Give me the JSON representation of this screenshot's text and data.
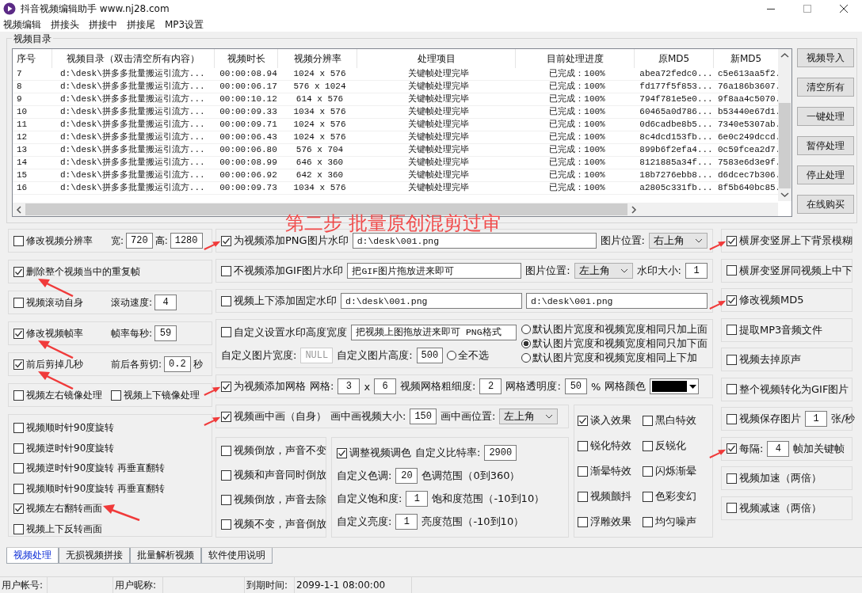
{
  "window": {
    "title": "抖音视频编辑助手 www.nj28.com"
  },
  "menu": [
    "视频编辑",
    "拼接头",
    "拼接中",
    "拼接尾",
    "MP3设置"
  ],
  "video_list": {
    "title": "视频目录",
    "columns": [
      "序号",
      "视频目录（双击清空所有内容）",
      "视频时长",
      "视频分辨率",
      "处理项目",
      "目前处理进度",
      "原MD5",
      "新MD5"
    ],
    "rows": [
      [
        "7",
        "d:\\desk\\拼多多批量搬运引流方...",
        "00:00:08.94",
        "1024 x 576",
        "关键帧处理完毕",
        "已完成：100%",
        "abea72fedc0...",
        "c5e613aa5f2."
      ],
      [
        "8",
        "d:\\desk\\拼多多批量搬运引流方...",
        "00:00:06.17",
        "576 x 1024",
        "关键帧处理完毕",
        "已完成：100%",
        "fd177f5f853...",
        "76a186b3607."
      ],
      [
        "9",
        "d:\\desk\\拼多多批量搬运引流方...",
        "00:00:10.12",
        "614 x 576",
        "关键帧处理完毕",
        "已完成：100%",
        "794f781e5e0...",
        "9f8aa4c5070."
      ],
      [
        "10",
        "d:\\desk\\拼多多批量搬运引流方...",
        "00:00:09.33",
        "1034 x 576",
        "关键帧处理完毕",
        "已完成：100%",
        "60465a0d786...",
        "b53440e67d1."
      ],
      [
        "11",
        "d:\\desk\\拼多多批量搬运引流方...",
        "00:00:09.71",
        "1024 x 576",
        "关键帧处理完毕",
        "已完成：100%",
        "0d6cadbe8b5...",
        "7340e5307ab."
      ],
      [
        "12",
        "d:\\desk\\拼多多批量搬运引流方...",
        "00:00:06.43",
        "1024 x 576",
        "关键帧处理完毕",
        "已完成：100%",
        "8c4dcd153fb...",
        "6e0c249dccd."
      ],
      [
        "13",
        "d:\\desk\\拼多多批量搬运引流方...",
        "00:00:06.80",
        "576 x 704",
        "关键帧处理完毕",
        "已完成：100%",
        "899b6f2efa4...",
        "0c59fcea2d7."
      ],
      [
        "14",
        "d:\\desk\\拼多多批量搬运引流方...",
        "00:00:08.99",
        "646 x 360",
        "关键帧处理完毕",
        "已完成：100%",
        "8121885a34f...",
        "7583e6d3e9f."
      ],
      [
        "15",
        "d:\\desk\\拼多多批量搬运引流方...",
        "00:00:06.92",
        "642 x 360",
        "关键帧处理完毕",
        "已完成：100%",
        "18b7276ebb8...",
        "d6dcec7b306."
      ],
      [
        "16",
        "d:\\desk\\拼多多批量搬运引流方...",
        "00:00:09.73",
        "1034 x 576",
        "关键帧处理完毕",
        "已完成：100%",
        "a2805c331fb...",
        "8f5b640bc85."
      ]
    ]
  },
  "side_buttons": [
    "视频导入",
    "清空所有",
    "一键处理",
    "暂停处理",
    "停止处理",
    "在线购买"
  ],
  "step_caption": "第二步 批量原创混剪过审",
  "left_panels": [
    {
      "lines": [
        [
          {
            "kind": "checkbox",
            "label": "修改视频分辨率",
            "checked": false
          },
          {
            "kind": "label",
            "text": "宽:"
          },
          {
            "kind": "field",
            "value": "720"
          },
          {
            "kind": "label",
            "text": "高:"
          },
          {
            "kind": "field",
            "value": "1280"
          }
        ]
      ]
    },
    {
      "lines": [
        [
          {
            "kind": "checkbox",
            "label": "删除整个视频当中的重复帧",
            "checked": true,
            "arrow": true
          }
        ]
      ]
    },
    {
      "lines": [
        [
          {
            "kind": "checkbox",
            "label": "视频滚动自身",
            "checked": false
          },
          {
            "kind": "label",
            "text": "滚动速度:"
          },
          {
            "kind": "field",
            "value": "4"
          }
        ]
      ]
    },
    {
      "lines": [
        [
          {
            "kind": "checkbox",
            "label": "修改视频帧率",
            "checked": true,
            "arrow": true
          },
          {
            "kind": "label",
            "text": "帧率每秒:"
          },
          {
            "kind": "field",
            "value": "59"
          }
        ]
      ]
    },
    {
      "lines": [
        [
          {
            "kind": "checkbox",
            "label": "前后剪掉几秒",
            "checked": true,
            "arrow": true
          },
          {
            "kind": "label",
            "text": "前后各剪切:"
          },
          {
            "kind": "field",
            "value": "0.2"
          },
          {
            "kind": "label",
            "text": "秒"
          }
        ]
      ]
    },
    {
      "lines": [
        [
          {
            "kind": "checkbox",
            "label": "视频左右镜像处理",
            "checked": false
          },
          {
            "kind": "checkbox",
            "label": "视频上下镜像处理",
            "checked": false
          }
        ]
      ]
    },
    {
      "lines": [
        [
          {
            "kind": "checkbox",
            "label": "视频顺时针90度旋转",
            "checked": false
          }
        ],
        [
          {
            "kind": "checkbox",
            "label": "视频逆时针90度旋转",
            "checked": false
          }
        ],
        [
          {
            "kind": "checkbox",
            "label": "视频逆时针90度旋转 再垂直翻转",
            "checked": false
          }
        ],
        [
          {
            "kind": "checkbox",
            "label": "视频顺时针90度旋转 再垂直翻转",
            "checked": false
          }
        ],
        [
          {
            "kind": "checkbox",
            "label": "视频左右翻转画面",
            "checked": true,
            "arrow": true
          }
        ],
        [
          {
            "kind": "checkbox",
            "label": "视频上下反转画面",
            "checked": false
          }
        ]
      ]
    }
  ],
  "middle_panels": [
    {
      "lines": [
        [
          {
            "kind": "checkbox",
            "label": "为视频添加PNG图片水印",
            "checked": true,
            "arrow": true
          },
          {
            "kind": "field",
            "value": "d:\\desk\\001.png"
          },
          {
            "kind": "label",
            "text": "图片位置:"
          },
          {
            "kind": "select",
            "value": "右上角"
          }
        ]
      ]
    },
    {
      "lines": [
        [
          {
            "kind": "checkbox",
            "label": "不视频添加GIF图片水印",
            "checked": false
          },
          {
            "kind": "field",
            "value": "把GIF图片拖放进来即可"
          },
          {
            "kind": "label",
            "text": "图片位置:"
          },
          {
            "kind": "select",
            "value": "左上角"
          },
          {
            "kind": "label",
            "text": "水印大小:"
          },
          {
            "kind": "field",
            "value": "1"
          }
        ]
      ]
    },
    {
      "lines": [
        [
          {
            "kind": "checkbox",
            "label": "视频上下添加固定水印",
            "checked": false
          },
          {
            "kind": "field",
            "value": "d:\\desk\\001.png"
          },
          {
            "kind": "field",
            "value": "d:\\desk\\001.png"
          }
        ]
      ]
    },
    {
      "lines": [
        [
          {
            "kind": "checkbox",
            "label": "自定义设置水印高度宽度",
            "checked": false
          },
          {
            "kind": "field",
            "value": "把视频上图拖放进来即可 PNG格式"
          }
        ],
        [
          {
            "kind": "label",
            "text": "自定义图片宽度:"
          },
          {
            "kind": "field",
            "value": "NULL",
            "disabled": true
          },
          {
            "kind": "label",
            "text": "自定义图片高度:"
          },
          {
            "kind": "field",
            "value": "500"
          },
          {
            "kind": "radio",
            "label": "全不选",
            "selected": false
          }
        ]
      ],
      "side": [
        {
          "kind": "radio",
          "label": "默认图片宽度和视频宽度相同只加上面",
          "selected": false
        },
        {
          "kind": "radio",
          "label": "默认图片宽度和视频宽度相同只加下面",
          "selected": true
        },
        {
          "kind": "radio",
          "label": "默认图片宽度和视频宽度相同上下加",
          "selected": false
        }
      ]
    },
    {
      "lines": [
        [
          {
            "kind": "checkbox",
            "label": "为视频添加网格",
            "checked": true,
            "arrow": true
          },
          {
            "kind": "label",
            "text": "网格:"
          },
          {
            "kind": "field",
            "value": "3"
          },
          {
            "kind": "label",
            "text": "x"
          },
          {
            "kind": "field",
            "value": "6"
          },
          {
            "kind": "label",
            "text": "视频网格粗细度:"
          },
          {
            "kind": "field",
            "value": "2"
          },
          {
            "kind": "label",
            "text": "网格透明度:"
          },
          {
            "kind": "field",
            "value": "50"
          },
          {
            "kind": "label",
            "text": "%"
          },
          {
            "kind": "label",
            "text": "网格颜色"
          },
          {
            "kind": "color",
            "color": "#000000"
          }
        ]
      ]
    }
  ],
  "pip_panel": {
    "lines": [
      [
        {
          "kind": "checkbox",
          "label": "视频画中画（自身）",
          "checked": true,
          "arrow": true
        },
        {
          "kind": "label",
          "text": "画中画视频大小:"
        },
        {
          "kind": "field",
          "value": "150"
        },
        {
          "kind": "label",
          "text": "画中画位置:"
        },
        {
          "kind": "select",
          "value": "左上角"
        }
      ]
    ]
  },
  "reverse_panel": {
    "lines": [
      [
        {
          "kind": "checkbox",
          "label": "视频倒放，声音不变",
          "checked": false
        }
      ],
      [
        {
          "kind": "checkbox",
          "label": "视频和声音同时倒放",
          "checked": false
        }
      ],
      [
        {
          "kind": "checkbox",
          "label": "视频倒放，声音去除",
          "checked": false
        }
      ],
      [
        {
          "kind": "checkbox",
          "label": "视频不变，声音倒放",
          "checked": false
        }
      ]
    ]
  },
  "color_panel": {
    "lines": [
      [
        {
          "kind": "checkbox",
          "label": "调整视频调色",
          "checked": true
        },
        {
          "kind": "label",
          "text": "自定义比特率:"
        },
        {
          "kind": "field",
          "value": "2900"
        }
      ],
      [
        {
          "kind": "label",
          "text": "自定义色调:"
        },
        {
          "kind": "field",
          "value": "20"
        },
        {
          "kind": "label",
          "text": "色调范围（0到360）"
        }
      ],
      [
        {
          "kind": "label",
          "text": "自定义饱和度:"
        },
        {
          "kind": "field",
          "value": "1"
        },
        {
          "kind": "label",
          "text": "饱和度范围（-10到10）"
        }
      ],
      [
        {
          "kind": "label",
          "text": "自定义亮度:"
        },
        {
          "kind": "field",
          "value": "1"
        },
        {
          "kind": "label",
          "text": "亮度范围（-10到10）"
        }
      ]
    ]
  },
  "effects_panel": {
    "lines": [
      [
        {
          "kind": "checkbox",
          "label": "谈入效果",
          "checked": true
        },
        {
          "kind": "checkbox",
          "label": "黑白特效",
          "checked": false
        }
      ],
      [
        {
          "kind": "checkbox",
          "label": "锐化特效",
          "checked": false
        },
        {
          "kind": "checkbox",
          "label": "反锐化",
          "checked": false
        }
      ],
      [
        {
          "kind": "checkbox",
          "label": "渐晕特效",
          "checked": false
        },
        {
          "kind": "checkbox",
          "label": "闪烁渐晕",
          "checked": false
        }
      ],
      [
        {
          "kind": "checkbox",
          "label": "视频颤抖",
          "checked": false
        },
        {
          "kind": "checkbox",
          "label": "色彩变幻",
          "checked": false
        }
      ],
      [
        {
          "kind": "checkbox",
          "label": "浮雕效果",
          "checked": false
        },
        {
          "kind": "checkbox",
          "label": "均匀噪声",
          "checked": false
        }
      ]
    ]
  },
  "right_panels": [
    {
      "lines": [
        [
          {
            "kind": "checkbox",
            "label": "横屏变竖屏上下背景模糊",
            "checked": true,
            "arrow": true
          }
        ]
      ]
    },
    {
      "lines": [
        [
          {
            "kind": "checkbox",
            "label": "横屏变竖屏同视频上中下",
            "checked": false
          }
        ]
      ]
    },
    {
      "lines": [
        [
          {
            "kind": "checkbox",
            "label": "修改视频MD5",
            "checked": true,
            "arrow": true
          }
        ]
      ]
    },
    {
      "lines": [
        [
          {
            "kind": "checkbox",
            "label": "提取MP3音频文件",
            "checked": false
          }
        ]
      ]
    },
    {
      "lines": [
        [
          {
            "kind": "checkbox",
            "label": "视频去掉原声",
            "checked": false
          }
        ]
      ]
    },
    {
      "lines": [
        [
          {
            "kind": "checkbox",
            "label": "整个视频转化为GIF图片",
            "checked": false
          }
        ]
      ]
    },
    {
      "lines": [
        [
          {
            "kind": "checkbox",
            "label": "视频保存图片",
            "checked": false
          },
          {
            "kind": "field",
            "value": "1"
          },
          {
            "kind": "label",
            "text": "张/秒"
          }
        ]
      ]
    },
    {
      "lines": [
        [
          {
            "kind": "checkbox",
            "label": "每隔:",
            "checked": true,
            "arrow": true
          },
          {
            "kind": "field",
            "value": "4"
          },
          {
            "kind": "label",
            "text": "帧加关键帧"
          }
        ]
      ]
    },
    {
      "lines": [
        [
          {
            "kind": "checkbox",
            "label": "视频加速（两倍）",
            "checked": false
          }
        ]
      ]
    },
    {
      "lines": [
        [
          {
            "kind": "checkbox",
            "label": "视频减速（两倍）",
            "checked": false
          }
        ]
      ]
    }
  ],
  "tabs": [
    {
      "label": "视频处理",
      "selected": true
    },
    {
      "label": "无损视频拼接",
      "selected": false
    },
    {
      "label": "批量解析视频",
      "selected": false
    },
    {
      "label": "软件使用说明",
      "selected": false
    }
  ],
  "status_bar": [
    {
      "label": "用户帐号:"
    },
    {
      "label": "用户昵称:"
    },
    {
      "label": "到期时间:",
      "value": "2099-1-1 08:00:00"
    }
  ]
}
